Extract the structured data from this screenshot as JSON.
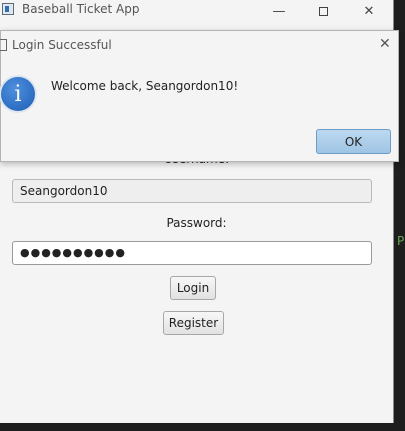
{
  "window": {
    "title": "Baseball Ticket App",
    "minimize_glyph": "—",
    "close_glyph": "✕"
  },
  "form": {
    "username_label": "Username:",
    "username_value": "Seangordon10",
    "password_label": "Password:",
    "password_masked": "●●●●●●●●●●",
    "login_label": "Login",
    "register_label": "Register"
  },
  "background": {
    "partial_text": "P"
  },
  "dialog": {
    "title": "Login Successful",
    "close_glyph": "✕",
    "info_glyph": "i",
    "message": "Welcome back, Seangordon10!",
    "ok_label": "OK"
  }
}
